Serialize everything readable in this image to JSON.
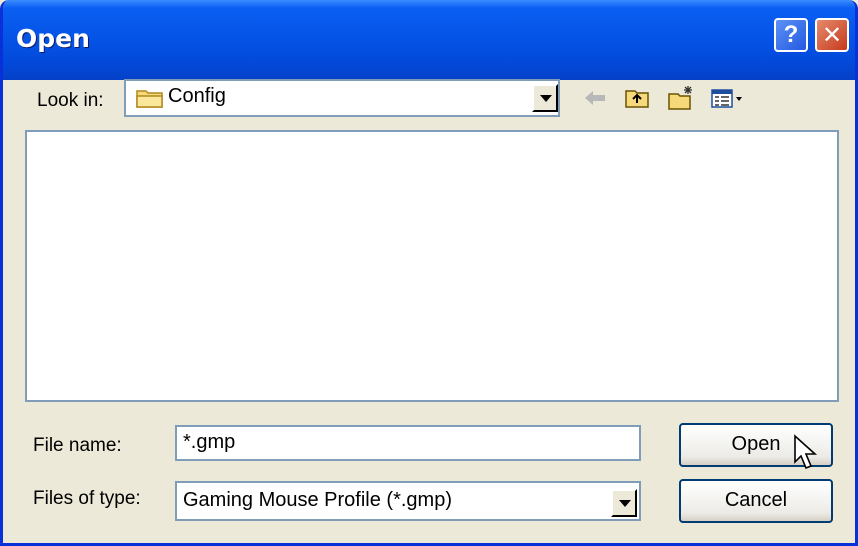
{
  "window": {
    "title": "Open",
    "help": "?",
    "close": "✕"
  },
  "lookin": {
    "label": "Look in:",
    "value": "Config"
  },
  "toolbar": {
    "icons": [
      "back-arrow-icon",
      "up-folder-icon",
      "new-folder-icon",
      "views-menu-icon"
    ]
  },
  "filename": {
    "label": "File name:",
    "value": "*.gmp"
  },
  "filetype": {
    "label": "Files of type:",
    "value": "Gaming Mouse Profile (*.gmp)"
  },
  "buttons": {
    "open": "Open",
    "cancel": "Cancel"
  },
  "colors": {
    "titlebar": "#0453E6",
    "face": "#ECE9D8",
    "border": "#7F9DB9",
    "close": "#C73A1C"
  }
}
